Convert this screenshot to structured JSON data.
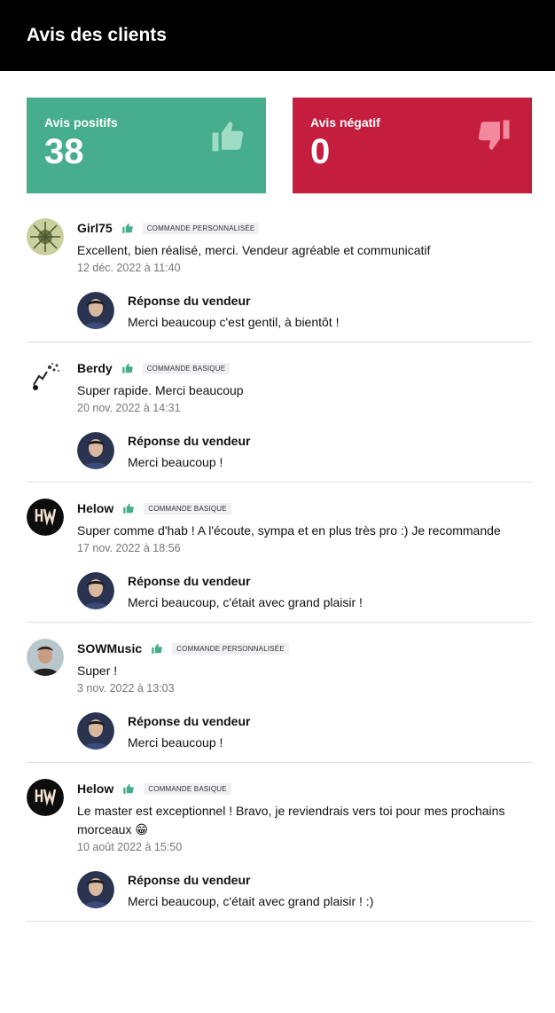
{
  "header": {
    "title": "Avis des clients"
  },
  "stats": {
    "positive": {
      "label": "Avis positifs",
      "value": "38",
      "color": "#46ae8c",
      "icon": "thumbs-up-icon"
    },
    "negative": {
      "label": "Avis négatif",
      "value": "0",
      "color": "#c41d3d",
      "icon": "thumbs-down-icon"
    }
  },
  "reply_title": "Réponse du vendeur",
  "reviews": [
    {
      "username": "Girl75",
      "badge": "Commande personnalisée",
      "text": "Excellent, bien réalisé, merci. Vendeur agréable et communicatif",
      "date": "12 déc. 2022 à 11:40",
      "reply": "Merci beaucoup c'est gentil, à bientôt !"
    },
    {
      "username": "Berdy",
      "badge": "Commande basique",
      "text": "Super rapide. Merci beaucoup",
      "date": "20 nov. 2022 à 14:31",
      "reply": "Merci beaucoup !"
    },
    {
      "username": "Helow",
      "badge": "Commande basique",
      "text": "Super comme d'hab ! A l'écoute, sympa et en plus très pro :) Je recommande",
      "date": "17 nov. 2022 à 18:56",
      "reply": "Merci beaucoup, c'était avec grand plaisir !"
    },
    {
      "username": "SOWMusic",
      "badge": "Commande personnalisée",
      "text": "Super !",
      "date": "3 nov. 2022 à 13:03",
      "reply": "Merci beaucoup !"
    },
    {
      "username": "Helow",
      "badge": "Commande basique",
      "text": "Le master est exceptionnel ! Bravo, je reviendrais vers toi pour mes prochains morceaux 😁",
      "date": "10 août 2022 à 15:50",
      "reply": "Merci beaucoup, c'était avec grand plaisir ! :)"
    }
  ]
}
